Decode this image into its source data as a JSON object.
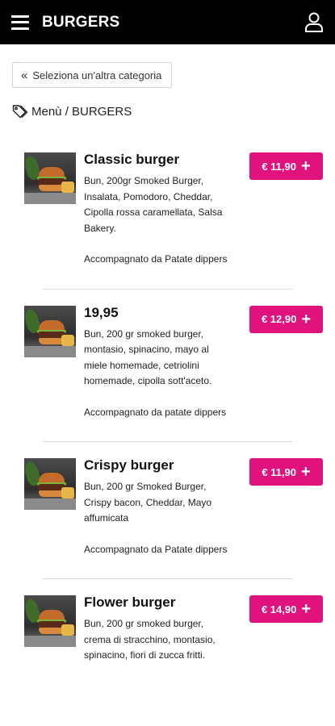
{
  "header": {
    "title": "BURGERS"
  },
  "back_button": {
    "label": "Seleziona un'altra categoria"
  },
  "breadcrumb": {
    "text": "Menù / BURGERS"
  },
  "colors": {
    "accent": "#e0127e",
    "topbar": "#000000"
  },
  "products": [
    {
      "name": "Classic burger",
      "description": "Bun, 200gr Smoked Burger, Insalata, Pomodoro, Cheddar, Cipolla rossa caramellata, Salsa Bakery.",
      "extra": "Accompagnato da Patate dippers",
      "price": "€ 11,90"
    },
    {
      "name": "19,95",
      "description": "Bun, 200 gr smoked burger, montasio, spinacino, mayo al miele homemade, cetriolini homemade, cipolla sott'aceto.",
      "extra": "Accompagnato da patate dippers",
      "price": "€ 12,90"
    },
    {
      "name": "Crispy burger",
      "description": "Bun, 200 gr Smoked Burger, Crispy bacon, Cheddar, Mayo affumicata",
      "extra": "Accompagnato da Patate dippers",
      "price": "€ 11,90"
    },
    {
      "name": "Flower burger",
      "description": "Bun, 200 gr smoked burger, crema di stracchino, montasio, spinacino, fiori di zucca fritti.",
      "extra": "",
      "price": "€ 14,90"
    }
  ]
}
